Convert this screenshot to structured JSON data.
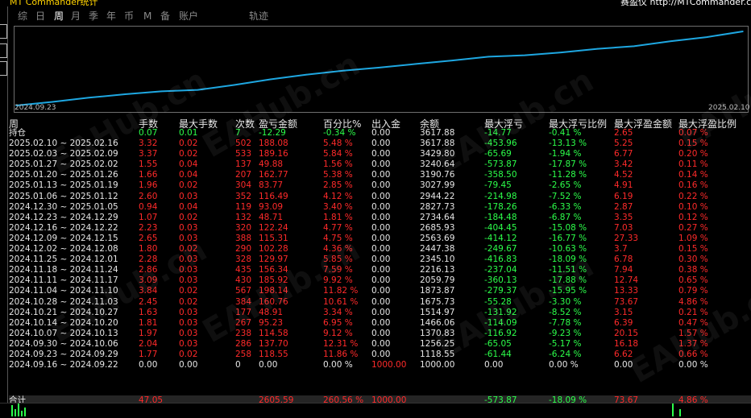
{
  "top": {
    "left_title": "MT Commander统计",
    "right_title": "赛盈仪 http://MTCommander.com"
  },
  "tabs": [
    {
      "label": "综",
      "active": false
    },
    {
      "label": "日",
      "active": false
    },
    {
      "label": "周",
      "active": true
    },
    {
      "label": "月",
      "active": false
    },
    {
      "label": "季",
      "active": false
    },
    {
      "label": "年",
      "active": false
    },
    {
      "label": "币",
      "active": false
    },
    {
      "label": "M",
      "active": false
    },
    {
      "label": "备",
      "active": false
    },
    {
      "label": "账户",
      "active": false
    },
    {
      "label": "轨迹",
      "active": false
    }
  ],
  "chart_data": {
    "type": "line",
    "x_start": "2024.09.23",
    "x_end": "2025.02.10",
    "series_color": "#1ea7e1",
    "x": [
      "2024.09.23",
      "2024.09.30",
      "2024.10.07",
      "2024.10.14",
      "2024.10.21",
      "2024.10.28",
      "2024.11.04",
      "2024.11.11",
      "2024.11.18",
      "2024.11.25",
      "2024.12.02",
      "2024.12.09",
      "2024.12.16",
      "2024.12.23",
      "2024.12.30",
      "2025.01.06",
      "2025.01.13",
      "2025.01.20",
      "2025.01.27",
      "2025.02.03",
      "2025.02.10"
    ],
    "y": [
      0,
      118.55,
      256.25,
      370.83,
      466.06,
      514.97,
      675.7,
      861.44,
      1017.78,
      1147.73,
      1250.01,
      1368.33,
      1483.68,
      1606.92,
      1655.63,
      1748.72,
      1867.81,
      1951.59,
      2114.36,
      2251.72,
      2440.88
    ],
    "grid": false
  },
  "table": {
    "headers": [
      "周",
      "手数",
      "最大手数",
      "次数",
      "盈亏金额",
      "百分比%",
      "出入金",
      "余额",
      "最大浮亏",
      "最大浮亏比例",
      "最大浮盈金额",
      "最大浮盈比例"
    ],
    "holding": [
      "持仓",
      "0.07",
      "0.01",
      "7",
      "-12.29",
      "-0.34 %",
      "0.00",
      "3617.88",
      "-14.77",
      "-0.41 %",
      "2.65",
      "0.07 %"
    ],
    "rows": [
      [
        "2025.02.10 ~ 2025.02.16",
        "3.32",
        "0.02",
        "502",
        "188.08",
        "5.48 %",
        "0.00",
        "3617.88",
        "-453.96",
        "-13.13 %",
        "5.25",
        "0.15 %"
      ],
      [
        "2025.02.03 ~ 2025.02.09",
        "3.37",
        "0.02",
        "533",
        "189.16",
        "5.84 %",
        "0.00",
        "3429.80",
        "-65.69",
        "-1.94 %",
        "6.77",
        "0.20 %"
      ],
      [
        "2025.01.27 ~ 2025.02.02",
        "1.55",
        "0.04",
        "137",
        "49.88",
        "1.56 %",
        "0.00",
        "3240.64",
        "-573.87",
        "-17.87 %",
        "3.42",
        "0.11 %"
      ],
      [
        "2025.01.20 ~ 2025.01.26",
        "1.66",
        "0.04",
        "207",
        "162.77",
        "5.38 %",
        "0.00",
        "3190.76",
        "-358.50",
        "-11.28 %",
        "4.52",
        "0.14 %"
      ],
      [
        "2025.01.13 ~ 2025.01.19",
        "1.96",
        "0.02",
        "304",
        "83.77",
        "2.85 %",
        "0.00",
        "3027.99",
        "-79.45",
        "-2.65 %",
        "4.91",
        "0.16 %"
      ],
      [
        "2025.01.06 ~ 2025.01.12",
        "2.60",
        "0.03",
        "352",
        "116.49",
        "4.12 %",
        "0.00",
        "2944.22",
        "-214.98",
        "-7.52 %",
        "6.19",
        "0.22 %"
      ],
      [
        "2024.12.30 ~ 2025.01.05",
        "0.94",
        "0.04",
        "119",
        "93.09",
        "3.40 %",
        "0.00",
        "2827.73",
        "-178.26",
        "-6.33 %",
        "2.87",
        "0.10 %"
      ],
      [
        "2024.12.23 ~ 2024.12.29",
        "1.07",
        "0.02",
        "132",
        "48.71",
        "1.81 %",
        "0.00",
        "2734.64",
        "-184.48",
        "-6.87 %",
        "3.35",
        "0.12 %"
      ],
      [
        "2024.12.16 ~ 2024.12.22",
        "2.23",
        "0.03",
        "320",
        "122.24",
        "4.77 %",
        "0.00",
        "2685.93",
        "-404.45",
        "-15.08 %",
        "7.03",
        "0.27 %"
      ],
      [
        "2024.12.09 ~ 2024.12.15",
        "2.65",
        "0.03",
        "388",
        "115.31",
        "4.75 %",
        "0.00",
        "2563.69",
        "-414.12",
        "-16.77 %",
        "27.33",
        "1.09 %"
      ],
      [
        "2024.12.02 ~ 2024.12.08",
        "1.80",
        "0.02",
        "290",
        "102.28",
        "4.36 %",
        "0.00",
        "2447.38",
        "-249.67",
        "-10.63 %",
        "3.7",
        "0.15 %"
      ],
      [
        "2024.11.25 ~ 2024.12.01",
        "2.28",
        "0.03",
        "328",
        "129.97",
        "5.85 %",
        "0.00",
        "2345.10",
        "-416.83",
        "-18.09 %",
        "6.78",
        "0.30 %"
      ],
      [
        "2024.11.18 ~ 2024.11.24",
        "2.86",
        "0.03",
        "435",
        "156.34",
        "7.59 %",
        "0.00",
        "2216.13",
        "-237.04",
        "-11.51 %",
        "7.94",
        "0.38 %"
      ],
      [
        "2024.11.11 ~ 2024.11.17",
        "3.09",
        "0.03",
        "430",
        "185.92",
        "9.92 %",
        "0.00",
        "2059.79",
        "-360.13",
        "-17.88 %",
        "12.74",
        "0.65 %"
      ],
      [
        "2024.11.04 ~ 2024.11.10",
        "3.84",
        "0.02",
        "567",
        "198.14",
        "11.82 %",
        "0.00",
        "1873.87",
        "-279.37",
        "-15.95 %",
        "13.33",
        "0.79 %"
      ],
      [
        "2024.10.28 ~ 2024.11.03",
        "2.45",
        "0.02",
        "384",
        "160.76",
        "10.61 %",
        "0.00",
        "1675.73",
        "-55.28",
        "-3.30 %",
        "73.67",
        "4.86 %"
      ],
      [
        "2024.10.21 ~ 2024.10.27",
        "1.63",
        "0.03",
        "177",
        "48.91",
        "3.34 %",
        "0.00",
        "1514.97",
        "-131.92",
        "-8.52 %",
        "3.15",
        "0.21 %"
      ],
      [
        "2024.10.14 ~ 2024.10.20",
        "1.81",
        "0.03",
        "267",
        "95.23",
        "6.95 %",
        "0.00",
        "1466.06",
        "-114.09",
        "-7.78 %",
        "6.39",
        "0.47 %"
      ],
      [
        "2024.10.07 ~ 2024.10.13",
        "1.97",
        "0.03",
        "238",
        "114.58",
        "9.12 %",
        "0.00",
        "1370.83",
        "-116.92",
        "-9.23 %",
        "20.15",
        "1.57 %"
      ],
      [
        "2024.09.30 ~ 2024.10.06",
        "2.04",
        "0.03",
        "286",
        "137.70",
        "12.31 %",
        "0.00",
        "1256.25",
        "-65.05",
        "-5.17 %",
        "16.18",
        "1.37 %"
      ],
      [
        "2024.09.23 ~ 2024.09.29",
        "1.77",
        "0.02",
        "258",
        "118.55",
        "11.86 %",
        "0.00",
        "1118.55",
        "-61.44",
        "-6.24 %",
        "6.62",
        "0.66 %"
      ],
      [
        "2024.09.16 ~ 2024.09.22",
        "0.00",
        "0.00",
        "0",
        "0.00",
        "0.00 %",
        "1000.00",
        "1000.00",
        "0.00",
        "0.00 %",
        "0.00",
        "0.00 %"
      ]
    ],
    "total": [
      "合计",
      "47.05",
      "",
      "",
      "2605.59",
      "260.56 %",
      "1000.00",
      "",
      "-573.87",
      "-18.09 %",
      "73.67",
      "4.86 %"
    ]
  },
  "watermark": "EAHub.cn",
  "colors": {
    "profit": "#ff2a2a",
    "loss": "#2cff4a",
    "line": "#1ea7e1",
    "active_tab": "#ffffff",
    "tab": "#8a8a8a"
  }
}
